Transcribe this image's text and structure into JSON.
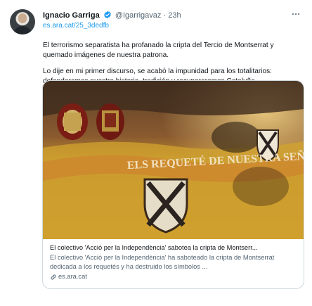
{
  "author": {
    "name": "Ignacio Garriga",
    "handle": "@Igarrigavaz",
    "time": "23h"
  },
  "link": "es.ara.cat/25_3dedfb",
  "tweet": {
    "paragraph1": "El terrorismo separatista ha profanado la cripta del Tercio de Montserrat y quemado imágenes de nuestra patrona.",
    "paragraph2": "Lo dije en mi primer discurso, se acabó la impunidad para los totalitarios: defenderemos nuestra historia, tradición y recuperaremos Cataluña"
  },
  "card": {
    "image_caption": "ELS REQUETÉ DE NUESTRA SEÑ",
    "title": "El colectivo 'Acció per la Independència' sabotea la cripta de Montserr...",
    "description": "El colectivo 'Acció per la Independència' ha saboteado la cripta de Montserrat dedicada a los requetés y ha destruido los símbolos ...",
    "domain": "es.ara.cat"
  },
  "colors": {
    "accent": "#1d9bf0",
    "banner_yellow": "#d2a32f",
    "banner_red": "#c0392b"
  },
  "icons": [
    "verified-badge-icon",
    "more-options-icon",
    "link-icon"
  ]
}
